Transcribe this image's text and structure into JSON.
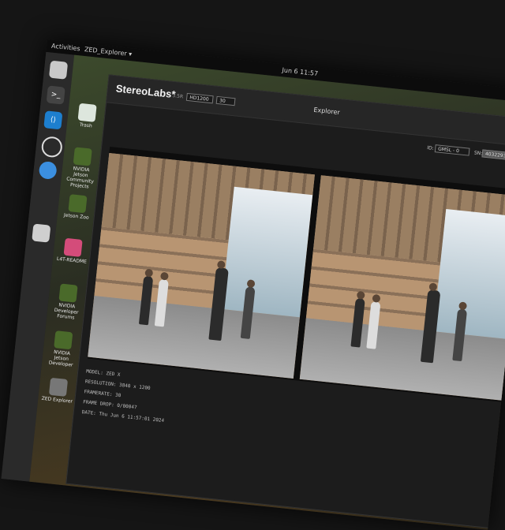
{
  "system": {
    "activities_label": "Activities",
    "app_menu_label": "ZED_Explorer ▾",
    "clock": "Jun 6 11:57"
  },
  "dock": [
    {
      "icon": "files-icon"
    },
    {
      "icon": "terminal-icon"
    },
    {
      "icon": "vscode-icon"
    },
    {
      "icon": "obs-icon"
    },
    {
      "icon": "chromium-icon"
    },
    {
      "icon": "recycle-icon"
    },
    {
      "icon": "apps-grid-icon"
    }
  ],
  "desktop": {
    "items": [
      {
        "label": "Trash"
      },
      {
        "label": "NVIDIA Jetson Community Projects"
      },
      {
        "label": "Jetson Zoo"
      },
      {
        "label": "L4T-README"
      },
      {
        "label": "NVIDIA Developer Forums"
      },
      {
        "label": "NVIDIA Jetson Developer"
      },
      {
        "label": "ZED Explorer"
      }
    ]
  },
  "window": {
    "brand": "StereoLabs*",
    "brand_version": "3.5R",
    "resolution_select": "HD1200",
    "fps_select": "30",
    "title": "Explorer",
    "camera_select_label": "ID:",
    "camera_select_value": "GMSL - 0",
    "serial_label": "SN:",
    "serial_value": "40322938"
  },
  "info": {
    "model": "MODEL: ZED X",
    "resolution": "RESOLUTION: 3840 x 1200",
    "framerate": "FRAMERATE: 30",
    "frame_drop": "FRAME DROP: 0/00047",
    "date": "DATE: Thu Jun 6 11:57:01 2024"
  }
}
